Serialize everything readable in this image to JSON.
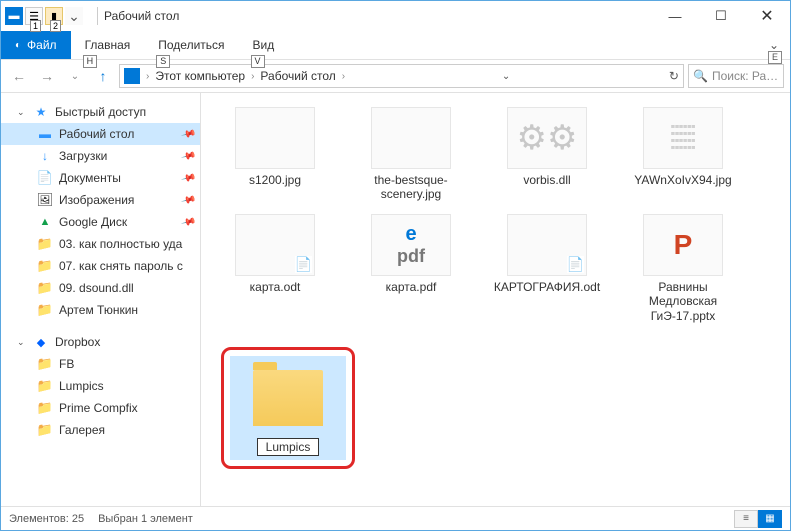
{
  "titlebar": {
    "title": "Рабочий стол",
    "badge1": "1",
    "badge2": "2"
  },
  "ribbon": {
    "file": "Файл",
    "tabs": [
      {
        "label": "Главная",
        "key": "H"
      },
      {
        "label": "Поделиться",
        "key": "S"
      },
      {
        "label": "Вид",
        "key": "V"
      }
    ],
    "chev_key": "E"
  },
  "address": {
    "crumbs": [
      "Этот компьютер",
      "Рабочий стол"
    ],
    "search_placeholder": "Поиск: Ра…"
  },
  "sidebar": {
    "quick": "Быстрый доступ",
    "items": [
      {
        "label": "Рабочий стол",
        "icon": "ico-desk",
        "pin": true,
        "selected": true
      },
      {
        "label": "Загрузки",
        "icon": "ico-down",
        "pin": true
      },
      {
        "label": "Документы",
        "icon": "ico-doc",
        "pin": true
      },
      {
        "label": "Изображения",
        "icon": "ico-img",
        "pin": true
      },
      {
        "label": "Google Диск",
        "icon": "ico-gdrive",
        "pin": true
      },
      {
        "label": "03. как полностью уда",
        "icon": "ico-folder"
      },
      {
        "label": "07. как снять пароль с",
        "icon": "ico-folder"
      },
      {
        "label": "09. dsound.dll",
        "icon": "ico-folder"
      },
      {
        "label": "Артем Тюнкин",
        "icon": "ico-folder"
      }
    ],
    "dropbox": "Dropbox",
    "dbitems": [
      {
        "label": "FB"
      },
      {
        "label": "Lumpics"
      },
      {
        "label": "Prime Compfix"
      },
      {
        "label": "Галерея"
      }
    ]
  },
  "files": [
    {
      "label": "s1200.jpg",
      "thumb": "img1"
    },
    {
      "label": "the-bestsque-scenery.jpg",
      "thumb": "img2"
    },
    {
      "label": "vorbis.dll",
      "thumb": "gear"
    },
    {
      "label": "YAWnXoIvX94.jpg",
      "thumb": "scan"
    },
    {
      "label": "карта.odt",
      "thumb": "page-doc"
    },
    {
      "label": "карта.pdf",
      "thumb": "pdf"
    },
    {
      "label": "КАРТОГРАФИЯ.odt",
      "thumb": "page-doc"
    },
    {
      "label": "Равнины Медловская ГиЭ-17.pptx",
      "thumb": "ppt"
    }
  ],
  "selected_folder": {
    "label": "Lumpics"
  },
  "status": {
    "count": "Элементов: 25",
    "sel": "Выбран 1 элемент"
  }
}
